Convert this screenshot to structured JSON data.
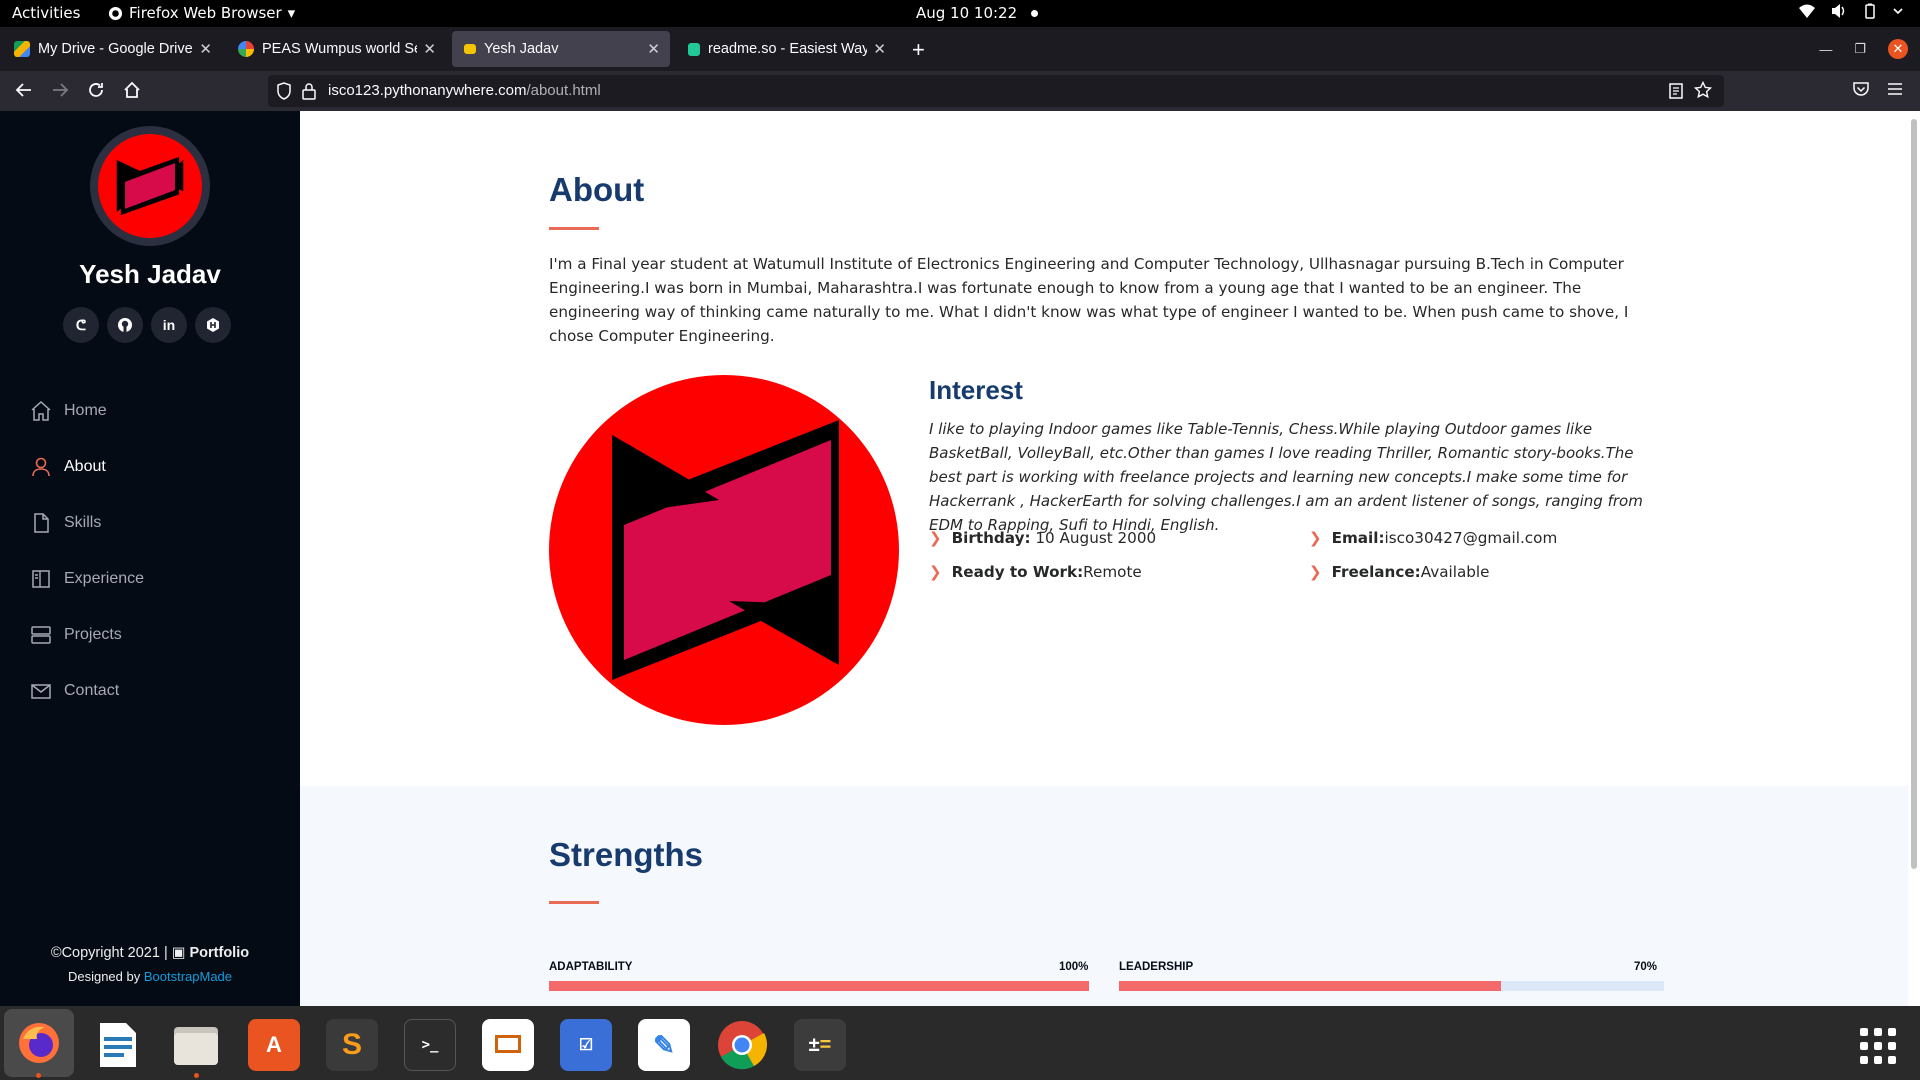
{
  "system": {
    "activities": "Activities",
    "app_menu": "Firefox Web Browser",
    "clock": "Aug 10  10:22"
  },
  "browser": {
    "tabs": [
      {
        "title": "My Drive - Google Drive",
        "favicon": "google-drive-icon"
      },
      {
        "title": "PEAS Wumpus world Sen",
        "favicon": "google-icon"
      },
      {
        "title": "Yesh Jadav",
        "favicon": "portfolio-icon"
      },
      {
        "title": "readme.so - Easiest Way",
        "favicon": "readme-icon"
      }
    ],
    "url_host": "isco123.pythonanywhere.com",
    "url_path": "/about.html"
  },
  "sidebar": {
    "name": "Yesh Jadav",
    "socials": [
      "codechef-icon",
      "github-icon",
      "linkedin-icon",
      "hackerrank-icon"
    ],
    "menu": [
      {
        "label": "Home",
        "icon": "home-icon"
      },
      {
        "label": "About",
        "icon": "person-icon",
        "active": true
      },
      {
        "label": "Skills",
        "icon": "file-icon"
      },
      {
        "label": "Experience",
        "icon": "book-icon"
      },
      {
        "label": "Projects",
        "icon": "server-icon"
      },
      {
        "label": "Contact",
        "icon": "envelope-icon"
      }
    ],
    "copyright": "Copyright 2021 |",
    "brand": "Portfolio",
    "designed_by": "Designed by",
    "designer": "BootstrapMade"
  },
  "about": {
    "title": "About",
    "text": "I'm a Final year student at Watumull Institute of Electronics Engineering and Computer Technology, Ullhasnagar pursuing B.Tech in Computer Engineering.I was born in Mumbai, Maharashtra.I was fortunate enough to know from a young age that I wanted to be an engineer. The engineering way of thinking came naturally to me. What I didn't know was what type of engineer I wanted to be. When push came to shove, I chose Computer Engineering.",
    "interest_title": "Interest",
    "interest_text": "I like to playing Indoor games like Table-Tennis, Chess.While playing Outdoor games like BasketBall, VolleyBall, etc.Other than games I love reading Thriller, Romantic story-books.The best part is working with freelance projects and learning new concepts.I make some time for Hackerrank , HackerEarth for solving challenges.I am an ardent listener of songs, ranging from EDM to Rapping, Sufi to Hindi, English.",
    "facts": [
      {
        "label": "Birthday:",
        "value": "10 August 2000"
      },
      {
        "label": "Email:",
        "value": "isco30427@gmail.com"
      },
      {
        "label": "Ready to Work:",
        "value": "Remote"
      },
      {
        "label": "Freelance:",
        "value": "Available"
      }
    ]
  },
  "strengths": {
    "title": "Strengths",
    "bars": [
      {
        "label": "ADAPTABILITY",
        "percent_label": "100%",
        "percent": 100
      },
      {
        "label": "LEADERSHIP",
        "percent_label": "70%",
        "percent": 70
      }
    ]
  },
  "dock": {
    "apps": [
      "firefox-icon",
      "writer-icon",
      "files-icon",
      "software-icon",
      "sublime-icon",
      "terminal-icon",
      "impress-icon",
      "tasks-icon",
      "text-editor-icon",
      "chrome-icon",
      "calculator-icon"
    ]
  },
  "colors": {
    "accent": "#e96b56",
    "title": "#173b6c",
    "sidebar_bg": "#040b14",
    "bar_fill": "#f46a6a",
    "logo_red": "#ff0000",
    "logo_pink": "#d70a4a"
  }
}
